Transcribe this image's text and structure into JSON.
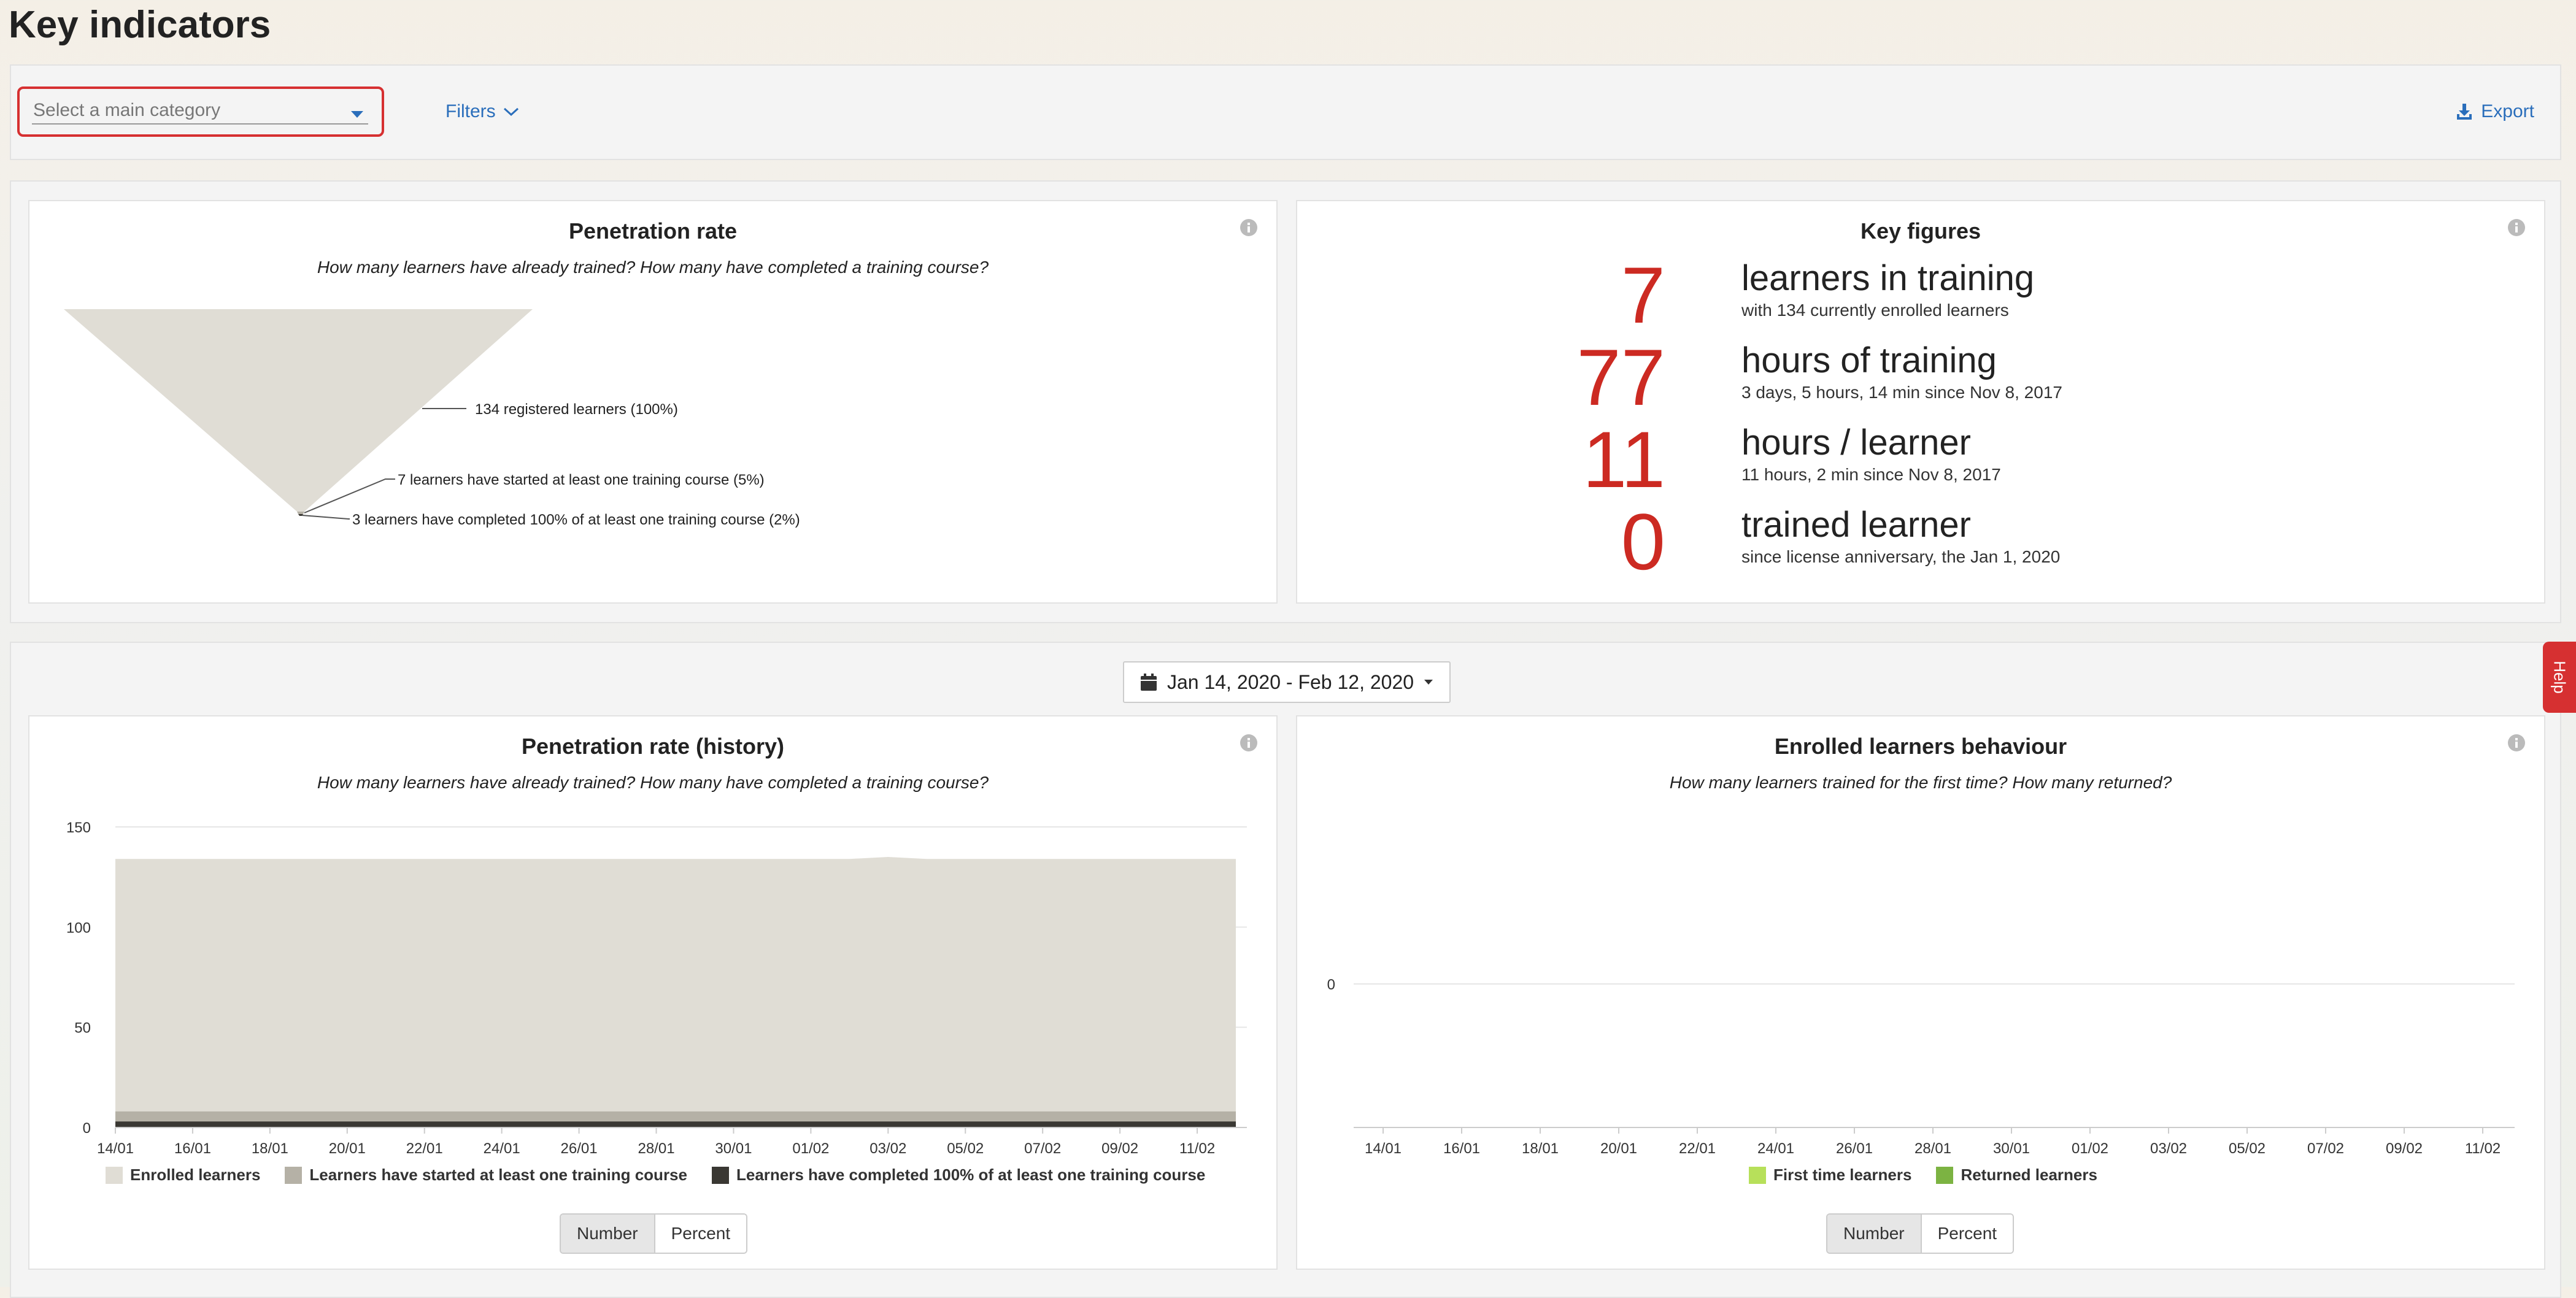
{
  "page": {
    "title": "Key indicators"
  },
  "toolbar": {
    "category_placeholder": "Select a main category",
    "filters_label": "Filters",
    "export_label": "Export"
  },
  "penetration": {
    "title": "Penetration rate",
    "subtitle": "How many learners have already trained? How many have completed a training course?",
    "funnel": {
      "labels": [
        "134 registered learners (100%)",
        "7 learners have started at least one training course (5%)",
        "3 learners have completed 100% of at least one training course (2%)"
      ]
    }
  },
  "key_figures": {
    "title": "Key figures",
    "items": [
      {
        "number": "7",
        "label": "learners in training",
        "sub": "with 134 currently enrolled learners"
      },
      {
        "number": "77",
        "label": "hours of training",
        "sub": "3 days, 5 hours, 14 min since Nov 8, 2017"
      },
      {
        "number": "11",
        "label": "hours / learner",
        "sub": "11 hours, 2 min since Nov 8, 2017"
      },
      {
        "number": "0",
        "label": "trained learner",
        "sub": "since license anniversary, the Jan 1, 2020"
      }
    ]
  },
  "date_range": {
    "label": "Jan 14, 2020 - Feb 12, 2020"
  },
  "history": {
    "title": "Penetration rate (history)",
    "subtitle": "How many learners have already trained? How many have completed a training course?",
    "toggle": {
      "number": "Number",
      "percent": "Percent"
    }
  },
  "behaviour": {
    "title": "Enrolled learners behaviour",
    "subtitle": "How many learners trained for the first time? How many returned?",
    "toggle": {
      "number": "Number",
      "percent": "Percent"
    }
  },
  "help": {
    "label": "Help"
  },
  "colors": {
    "accent": "#2a6ebb",
    "highlight": "#d63031",
    "kpi_number": "#cc2a22",
    "enrolled": "#e0ddd5",
    "started": "#b5b1a6",
    "completed": "#3a3833",
    "first_time": "#b7e05a",
    "returned": "#7cb342"
  },
  "chart_data": [
    {
      "type": "area",
      "title": "Penetration rate (history)",
      "x": [
        "14/01",
        "15/01",
        "16/01",
        "17/01",
        "18/01",
        "19/01",
        "20/01",
        "21/01",
        "22/01",
        "23/01",
        "24/01",
        "25/01",
        "26/01",
        "27/01",
        "28/01",
        "29/01",
        "30/01",
        "31/01",
        "01/02",
        "02/02",
        "03/02",
        "04/02",
        "05/02",
        "06/02",
        "07/02",
        "08/02",
        "09/02",
        "10/02",
        "11/02",
        "12/02"
      ],
      "xticks": [
        "14/01",
        "16/01",
        "18/01",
        "20/01",
        "22/01",
        "24/01",
        "26/01",
        "28/01",
        "30/01",
        "01/02",
        "03/02",
        "05/02",
        "07/02",
        "09/02",
        "11/02"
      ],
      "yticks": [
        0,
        50,
        100,
        150
      ],
      "ylim": [
        0,
        150
      ],
      "series": [
        {
          "name": "Enrolled learners",
          "color": "#e0ddd5",
          "values": [
            134,
            134,
            134,
            134,
            134,
            134,
            134,
            134,
            134,
            134,
            134,
            134,
            134,
            134,
            134,
            134,
            134,
            134,
            134,
            134,
            135,
            134,
            134,
            134,
            134,
            134,
            134,
            134,
            134,
            134
          ]
        },
        {
          "name": "Learners have started at least one training course",
          "color": "#b5b1a6",
          "values": [
            8,
            8,
            8,
            8,
            8,
            8,
            8,
            8,
            8,
            8,
            8,
            8,
            8,
            8,
            8,
            8,
            8,
            8,
            8,
            8,
            8,
            8,
            8,
            8,
            8,
            8,
            8,
            8,
            8,
            8
          ]
        },
        {
          "name": "Learners have completed 100% of at least one training course",
          "color": "#3a3833",
          "values": [
            3,
            3,
            3,
            3,
            3,
            3,
            3,
            3,
            3,
            3,
            3,
            3,
            3,
            3,
            3,
            3,
            3,
            3,
            3,
            3,
            3,
            3,
            3,
            3,
            3,
            3,
            3,
            3,
            3,
            3
          ]
        }
      ]
    },
    {
      "type": "bar",
      "title": "Enrolled learners behaviour",
      "xticks": [
        "14/01",
        "16/01",
        "18/01",
        "20/01",
        "22/01",
        "24/01",
        "26/01",
        "28/01",
        "30/01",
        "01/02",
        "03/02",
        "05/02",
        "07/02",
        "09/02",
        "11/02"
      ],
      "yticks": [
        0
      ],
      "series": [
        {
          "name": "First time learners",
          "color": "#b7e05a",
          "values": []
        },
        {
          "name": "Returned learners",
          "color": "#7cb342",
          "values": []
        }
      ]
    }
  ]
}
